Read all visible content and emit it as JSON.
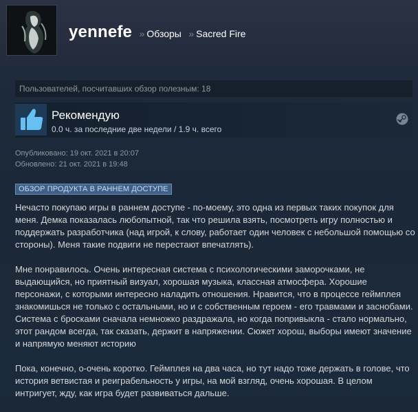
{
  "header": {
    "username": "yennefe",
    "separator": "»",
    "breadcrumb_reviews": "Обзоры",
    "breadcrumb_game": "Sacred Fire"
  },
  "helpful_text": "Пользователей, посчитавших обзор полезным: 18",
  "recommendation": {
    "title": "Рекомендую",
    "hours": "0.0 ч. за последние две недели / 1.9 ч. всего",
    "icon": "thumbs-up-icon",
    "platform_icon": "steam-icon"
  },
  "dates": {
    "published": "Опубликовано: 19 окт. 2021 в 20:07",
    "updated": "Обновлено: 21 окт. 2021 в 19:48"
  },
  "badge": "ОБЗОР ПРОДУКТА В РАННЕМ ДОСТУПЕ",
  "review": {
    "p1": "Нечасто покупаю игры в раннем доступе - по-моему, это одна из первых таких покупок для меня. Демка показалась любопытной, так что решила взять, посмотреть игру полностью и поддержать разработчика (над игрой, к слову, работает один человек с небольшой помощью со стороны). Меня такие подвиги не перестают впечатлять).",
    "p2": "Мне понравилось. Очень интересная система с психологическими заморочками, не выдающийся, но приятный визуал, хорошая музыка, классная атмосфера. Хорошие персонажи, с которыми интересно наладить отношения. Нравится, что в процессе геймплея знакомишься не только с остальными, но и с собственным героем - его травмами и заснобами. Система с бросками сначала немножко раздражала, но когда попривыкла - стало нормально, этот рандом всегда, так сказать, держит в напряжении. Сюжет хорош, выборы имеют значение и напрямую меняют историю",
    "p3": "Пока, конечно, о-очень коротко. Геймплея на два часа, но тут надо тоже держать в голове, что история ветвистая и реиграбельность у игры, на мой взгляд, очень хорошая. В целом интригует, жду, как игра будет развиваться дальше."
  }
}
